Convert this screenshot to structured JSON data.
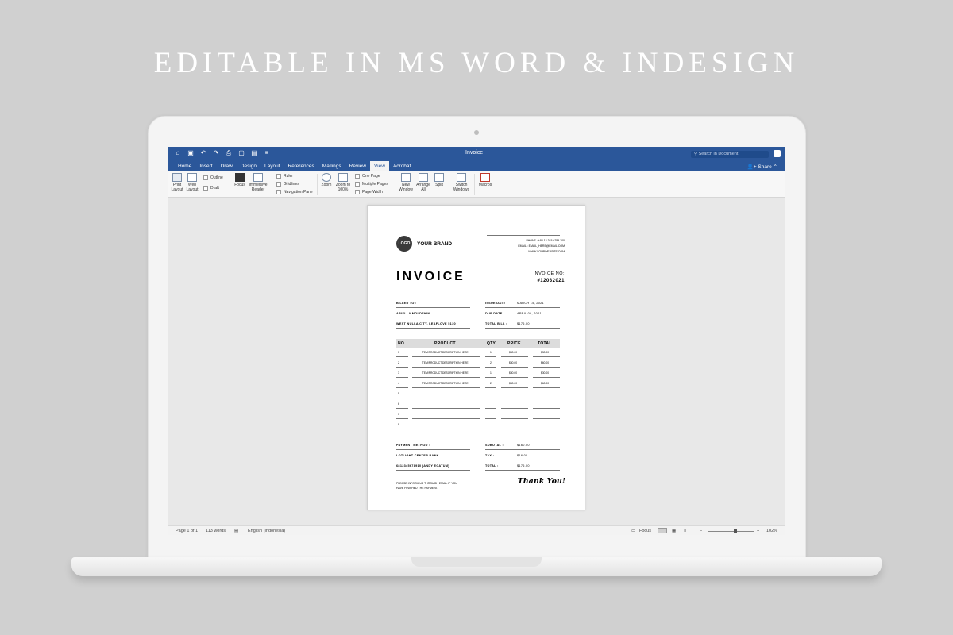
{
  "headline": "EDITABLE IN MS WORD & INDESIGN",
  "word": {
    "doc_title": "Invoice",
    "search_placeholder": "Search in Document",
    "share": "Share",
    "tabs": [
      "Home",
      "Insert",
      "Draw",
      "Design",
      "Layout",
      "References",
      "Mailings",
      "Review",
      "View",
      "Acrobat"
    ],
    "active_tab": "View",
    "ribbon": {
      "print_layout": "Print Layout",
      "web_layout": "Web Layout",
      "outline": "Outline",
      "draft": "Draft",
      "focus": "Focus",
      "immersive_reader": "Immersive Reader",
      "ruler": "Ruler",
      "gridlines": "Gridlines",
      "navigation_pane": "Navigation Pane",
      "zoom": "Zoom",
      "zoom100": "Zoom to 100%",
      "one_page": "One Page",
      "multiple_pages": "Multiple Pages",
      "page_width": "Page Width",
      "new_window": "New Window",
      "arrange_all": "Arrange All",
      "split": "Split",
      "switch_windows": "Switch Windows",
      "macros": "Macros"
    },
    "status": {
      "page": "Page 1 of 1",
      "words": "113 words",
      "language": "English (Indonesia)",
      "focus": "Focus",
      "zoom": "102%"
    }
  },
  "invoice": {
    "logo": "LOGO",
    "brand": "YOUR BRAND",
    "phone": "PHONE : +88 12 345 6789 100",
    "email": "EMAIL : EMAIL_HERE@EMAIL.COM",
    "website": "WWW.YOURWEBSITE.COM",
    "title": "INVOICE",
    "invoice_no_label": "INVOICE NO:",
    "invoice_no": "#12032021",
    "billed_to_label": "BILLED TO :",
    "billed_name": "ARIELLA MOLDEKIN",
    "billed_address": "WEST NULLA CITY, LEAFLOVE 5130",
    "issue_date_label": "ISSUE DATE :",
    "issue_date": "MARCH 15, 2021",
    "due_date_label": "DUE DATE :",
    "due_date": "APRIL 08, 2021",
    "total_bill_label": "TOTAL BILL :",
    "total_bill": "$176.00",
    "headers": {
      "no": "NO",
      "product": "PRODUCT",
      "qty": "QTY",
      "price": "PRICE",
      "total": "TOTAL"
    },
    "items": [
      {
        "no": "1",
        "product": "ITEM/PRODUCT DESCRIPTION HERE",
        "qty": "1",
        "price": "$30.00",
        "total": "$30.00"
      },
      {
        "no": "2",
        "product": "ITEM/PRODUCT DESCRIPTION HERE",
        "qty": "2",
        "price": "$30.00",
        "total": "$60.00"
      },
      {
        "no": "3",
        "product": "ITEM/PRODUCT DESCRIPTION HERE",
        "qty": "1",
        "price": "$30.00",
        "total": "$30.00"
      },
      {
        "no": "4",
        "product": "ITEM/PRODUCT DESCRIPTION HERE",
        "qty": "2",
        "price": "$30.00",
        "total": "$60.00"
      },
      {
        "no": "5",
        "product": "",
        "qty": "",
        "price": "",
        "total": ""
      },
      {
        "no": "6",
        "product": "",
        "qty": "",
        "price": "",
        "total": ""
      },
      {
        "no": "7",
        "product": "",
        "qty": "",
        "price": "",
        "total": ""
      },
      {
        "no": "8",
        "product": "",
        "qty": "",
        "price": "",
        "total": ""
      }
    ],
    "payment_method_label": "PAYMENT METHOD :",
    "bank": "LOTLIGHT CENTER BANK",
    "account": "6812345678910 (ANDY ECATUM)",
    "subtotal_label": "SUBOTAL :",
    "subtotal": "$160.00",
    "tax_label": "TAX :",
    "tax": "$16.00",
    "total_label": "TOTAL :",
    "total": "$176.00",
    "note_line1": "PLEASE INFORM US THROUGH EMAIL IF YOU",
    "note_line2": "HAVE FINISHED THE PAYMENT.",
    "thanks": "Thank You!"
  }
}
